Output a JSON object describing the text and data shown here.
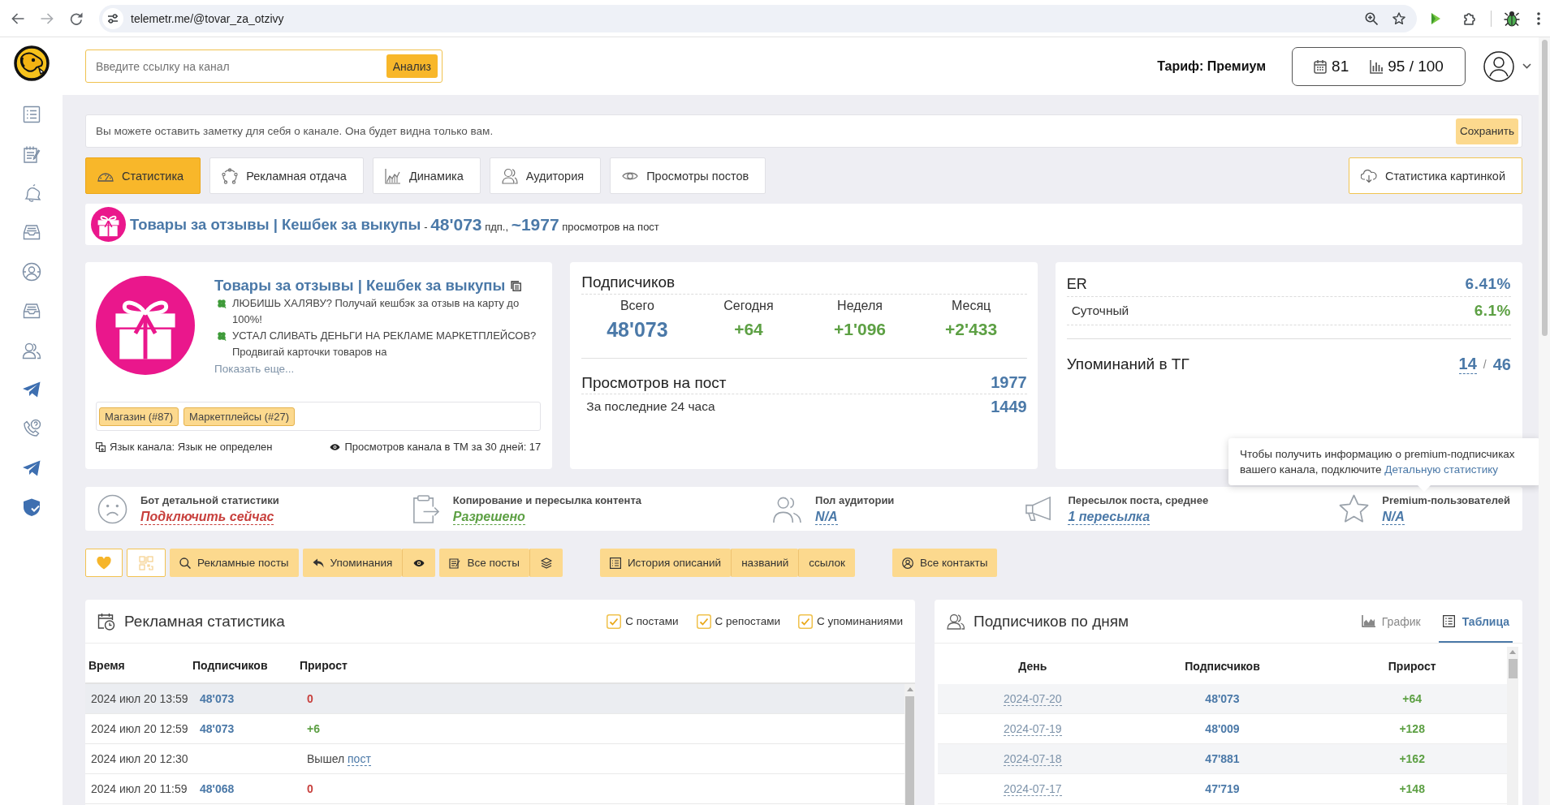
{
  "browser": {
    "url": "telemetr.me/@tovar_za_otzivy"
  },
  "header": {
    "search": {
      "placeholder": "Введите ссылку на канал",
      "button": "Анализ"
    },
    "tariff": "Тариф: Премиум",
    "counters": [
      "81",
      "95 / 100"
    ]
  },
  "note": {
    "placeholder": "Вы можете оставить заметку для себя о канале. Она будет видна только вам.",
    "button": "Сохранить"
  },
  "tabs": [
    {
      "label": "Статистика",
      "selected": true
    },
    {
      "label": "Рекламная отдача",
      "selected": false
    },
    {
      "label": "Динамика",
      "selected": false
    },
    {
      "label": "Аудитория",
      "selected": false
    },
    {
      "label": "Просмотры постов",
      "selected": false
    }
  ],
  "image_button": "Статистика картинкой",
  "channel_bar": {
    "title": "Товары за отзывы | Кешбек за выкупы",
    "separator": "-",
    "subscribers": "48'073",
    "subscribers_unit": "пдп.,",
    "views": "~1977",
    "views_unit": "просмотров на пост"
  },
  "channel_card": {
    "title": "Товары за отзывы | Кешбек за выкупы",
    "description": [
      "ЛЮБИШЬ ХАЛЯВУ? Получай кешбэк за отзыв на карту до 100%!",
      "УСТАЛ СЛИВАТЬ ДЕНЬГИ НА РЕКЛАМЕ МАРКЕТПЛЕЙСОВ? Продвигай карточки товаров на"
    ],
    "show_more": "Показать еще...",
    "tags": [
      "Магазин (#87)",
      "Маркетплейсы (#27)"
    ],
    "language": "Язык канала: Язык не определен",
    "views_tm": "Просмотров канала в ТМ за 30 дней: 17"
  },
  "subscribers_card": {
    "title": "Подписчиков",
    "stats": [
      {
        "kind": "total",
        "label": "Всего",
        "value": "48'073"
      },
      {
        "kind": "growth",
        "label": "Сегодня",
        "value": "+64"
      },
      {
        "kind": "growth",
        "label": "Неделя",
        "value": "+1'096"
      },
      {
        "kind": "growth",
        "label": "Месяц",
        "value": "+2'433"
      }
    ],
    "views": {
      "label": "Просмотров на пост",
      "value": "1977"
    },
    "views_24h": {
      "label": "За последние 24 часа",
      "value": "1449"
    }
  },
  "er_card": {
    "er": {
      "label": "ER",
      "value": "6.41%"
    },
    "daily": {
      "label": "Суточный",
      "value": "6.1%"
    },
    "mentions": {
      "label": "Упоминаний в ТГ",
      "value": "14",
      "separator": "/",
      "total": "46"
    }
  },
  "tooltip": {
    "text": "Чтобы получить информацию о premium-подписчиках вашего канала, подключите",
    "link": "Детальную статистику"
  },
  "info_bar": [
    {
      "label": "Бот детальной статистики",
      "value": "Подключить сейчас",
      "color": "#c8403d"
    },
    {
      "label": "Копирование и пересылка контента",
      "value": "Разрешено",
      "color": "#5da044"
    },
    {
      "label": "Пол аудитории",
      "value": "N/A",
      "color": "#4b79a8"
    },
    {
      "label": "Пересылок поста, среднее",
      "value": "1 пересылка",
      "color": "#4b79a8"
    },
    {
      "label": "Premium-пользователей",
      "value": "N/A",
      "color": "#4b79a8"
    }
  ],
  "toolbar": [
    {
      "groups": [
        {
          "buttons": [
            {
              "kind": "favorite"
            }
          ]
        },
        {
          "buttons": [
            {
              "kind": "similar"
            }
          ]
        },
        {
          "buttons": [
            {
              "kind": "ads",
              "label": "Рекламные посты"
            }
          ]
        },
        {
          "buttons": [
            {
              "kind": "mentions",
              "label": "Упоминания"
            },
            {
              "kind": "views"
            }
          ]
        },
        {
          "buttons": [
            {
              "kind": "posts",
              "label": "Все посты"
            },
            {
              "kind": "stack"
            }
          ]
        }
      ]
    },
    {
      "groups": [
        {
          "buttons": [
            {
              "kind": "history",
              "label": "История описаний"
            },
            {
              "kind": "text",
              "label": "названий"
            },
            {
              "kind": "text",
              "label": "ссылок"
            }
          ]
        }
      ]
    },
    {
      "groups": [
        {
          "buttons": [
            {
              "kind": "contacts",
              "label": "Все контакты"
            }
          ]
        }
      ]
    }
  ],
  "ad_stats": {
    "title": "Рекламная статистика",
    "filters": [
      {
        "label": "С постами",
        "checked": true
      },
      {
        "label": "С репостами",
        "checked": true
      },
      {
        "label": "С упоминаниями",
        "checked": true
      }
    ],
    "columns": [
      "Время",
      "Подписчиков",
      "Прирост"
    ],
    "rows": [
      {
        "kind": "count",
        "time": "2024 июл 20 13:59",
        "subscribers": "48'073",
        "growth": {
          "value": "0",
          "color": "#c8403d"
        },
        "highlighted": true
      },
      {
        "kind": "count",
        "time": "2024 июл 20 12:59",
        "subscribers": "48'073",
        "growth": {
          "value": "+6",
          "color": "#5da044"
        },
        "highlighted": false
      },
      {
        "kind": "event",
        "time": "2024 июл 20 12:30",
        "event": "Вышел",
        "link": "пост",
        "highlighted": false
      },
      {
        "kind": "count",
        "time": "2024 июл 20 11:59",
        "subscribers": "48'068",
        "growth": {
          "value": "0",
          "color": "#c8403d"
        },
        "highlighted": false
      }
    ]
  },
  "subs_by_day": {
    "title": "Подписчиков по дням",
    "views": [
      {
        "label": "График",
        "selected": false
      },
      {
        "label": "Таблица",
        "selected": true
      }
    ],
    "columns": [
      "День",
      "Подписчиков",
      "Прирост"
    ],
    "rows": [
      {
        "day": "2024-07-20",
        "subscribers": "48'073",
        "growth": "+64"
      },
      {
        "day": "2024-07-19",
        "subscribers": "48'009",
        "growth": "+128"
      },
      {
        "day": "2024-07-18",
        "subscribers": "47'881",
        "growth": "+162"
      },
      {
        "day": "2024-07-17",
        "subscribers": "47'719",
        "growth": "+148"
      }
    ]
  }
}
